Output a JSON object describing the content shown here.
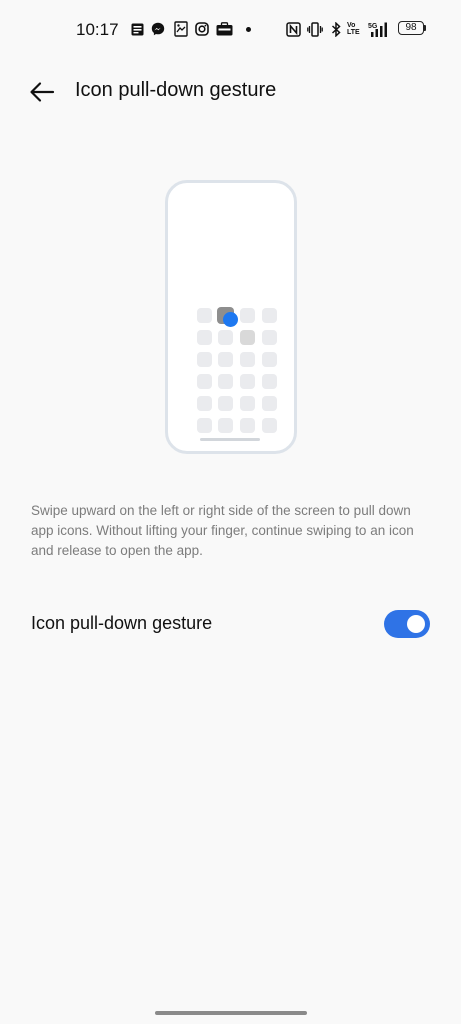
{
  "status_bar": {
    "time": "10:17",
    "battery": "98",
    "network": "5G",
    "volte": "Vo LTE",
    "icons": [
      "notification-icon",
      "messenger-icon",
      "gallery-icon",
      "instagram-icon",
      "briefcase-icon",
      "nfc-icon",
      "vibrate-icon",
      "bluetooth-icon",
      "volte-icon",
      "signal-icon",
      "battery-icon"
    ]
  },
  "header": {
    "title": "Icon pull-down gesture",
    "back_icon": "arrow-left-icon"
  },
  "description": "Swipe upward on the left or right side of the screen to pull down app icons. Without lifting your finger, continue swiping to an icon and release to open the app.",
  "setting": {
    "label": "Icon pull-down gesture",
    "enabled": true
  },
  "colors": {
    "background": "#f9f9f9",
    "accent": "#2f73e6",
    "touch_dot": "#1e78f0",
    "text_primary": "#111111",
    "text_secondary": "#7c7c7c"
  }
}
